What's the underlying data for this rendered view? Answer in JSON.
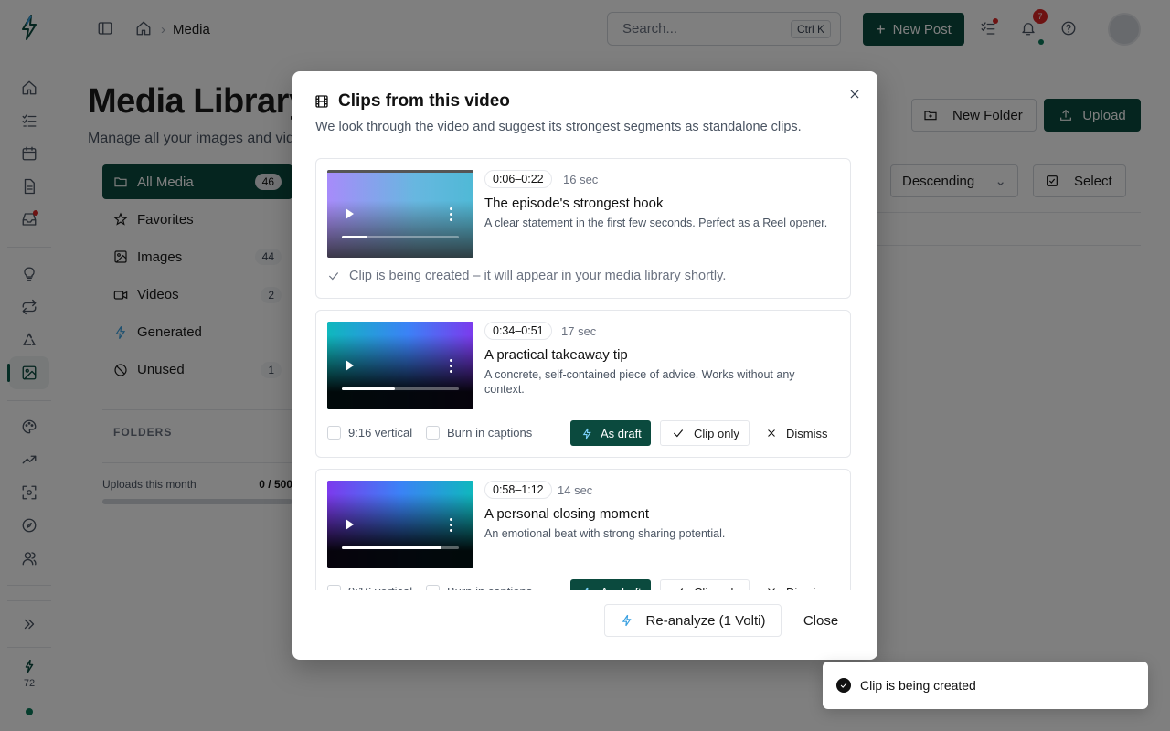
{
  "colors": {
    "brand": "#0b4a3e",
    "alert": "#dc2626",
    "online": "#0b7a5a"
  },
  "sidebar_rail": {
    "icons": [
      "home-icon",
      "checklist-icon",
      "calendar-icon",
      "document-icon",
      "inbox-icon",
      "lightbulb-icon",
      "repeat-icon",
      "recycle-icon",
      "media-icon",
      "palette-icon",
      "trending-icon",
      "scan-icon",
      "compass-icon",
      "users-icon",
      "expand-icon"
    ],
    "credits": "72"
  },
  "header": {
    "breadcrumb": "Media",
    "search_placeholder": "Search...",
    "search_shortcut": "Ctrl K",
    "new_post": "New Post",
    "notification_count": "7"
  },
  "page": {
    "title": "Media Library",
    "subtitle": "Manage all your images and videos",
    "new_folder": "New Folder",
    "upload": "Upload",
    "sort": "Descending",
    "select": "Select"
  },
  "nav": [
    {
      "label": "All Media",
      "count": "46",
      "icon": "folder-icon"
    },
    {
      "label": "Favorites",
      "count": "",
      "icon": "star-icon"
    },
    {
      "label": "Images",
      "count": "44",
      "icon": "image-icon"
    },
    {
      "label": "Videos",
      "count": "2",
      "icon": "video-icon"
    },
    {
      "label": "Generated",
      "count": "",
      "icon": "bolt-icon"
    },
    {
      "label": "Unused",
      "count": "1",
      "icon": "slash-icon"
    }
  ],
  "folders_label": "FOLDERS",
  "uploads": {
    "label": "Uploads this month",
    "value": "0 / 500",
    "fraction": 0
  },
  "modal": {
    "title": "Clips from this video",
    "description": "We look through the video and suggest its strongest segments as standalone clips.",
    "clips": [
      {
        "range": "0:06–0:22",
        "duration": "16 sec",
        "title": "The episode's strongest hook",
        "description": "A clear statement in the first few seconds. Perfect as a Reel opener.",
        "status": "Clip is being created – it will appear in your media library shortly.",
        "progress": 0.22
      },
      {
        "range": "0:34–0:51",
        "duration": "17 sec",
        "title": "A practical takeaway tip",
        "description": "A concrete, self-contained piece of advice. Works without any context.",
        "progress": 0.45
      },
      {
        "range": "0:58–1:12",
        "duration": "14 sec",
        "title": "A personal closing moment",
        "description": "An emotional beat with strong sharing potential.",
        "progress": 0.85
      }
    ],
    "option_vertical": "9:16 vertical",
    "option_captions": "Burn in captions",
    "as_draft": "As draft",
    "clip_only": "Clip only",
    "dismiss": "Dismiss",
    "reanalyze": "Re-analyze (1 Volti)",
    "close": "Close"
  },
  "toast": {
    "message": "Clip is being created"
  }
}
